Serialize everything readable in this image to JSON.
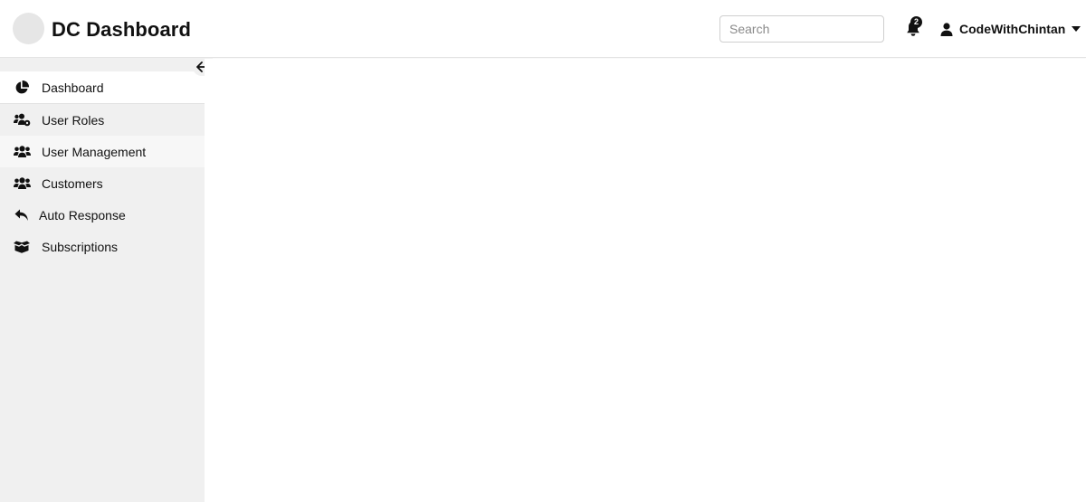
{
  "header": {
    "brand": "DC Dashboard",
    "search_placeholder": "Search",
    "notification_count": "2",
    "user_name": "CodeWithChintan"
  },
  "sidebar": {
    "items": [
      {
        "label": "Dashboard",
        "icon": "pie-chart-icon",
        "active": true
      },
      {
        "label": "User Roles",
        "icon": "users-cog-icon"
      },
      {
        "label": "User Management",
        "icon": "users-icon"
      },
      {
        "label": "Customers",
        "icon": "users-icon"
      },
      {
        "label": "Auto Response",
        "icon": "reply-icon"
      },
      {
        "label": "Subscriptions",
        "icon": "box-open-icon"
      }
    ]
  },
  "colors": {
    "sidebar_bg": "#f0f0f0",
    "active_bg": "#ffffff",
    "text": "#111111"
  }
}
